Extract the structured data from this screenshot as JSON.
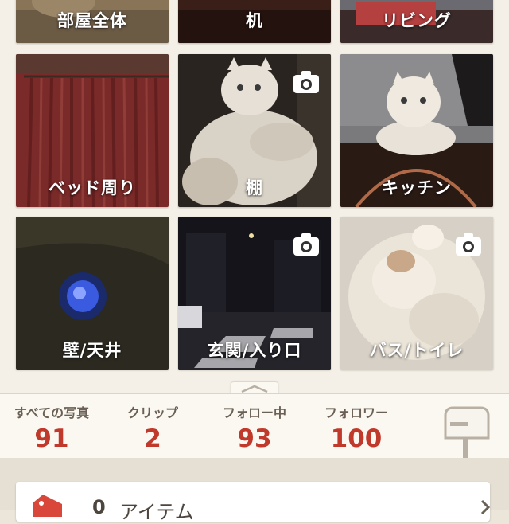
{
  "rooms": {
    "row0": [
      {
        "label": "部屋全体"
      },
      {
        "label": "机"
      },
      {
        "label": "リビング"
      }
    ],
    "row1": [
      {
        "label": "ベッド周り"
      },
      {
        "label": "棚"
      },
      {
        "label": "キッチン"
      }
    ],
    "row2": [
      {
        "label": "壁/天井"
      },
      {
        "label": "玄関/入り口"
      },
      {
        "label": "バス/トイレ"
      }
    ]
  },
  "stats": {
    "all_photos": {
      "label": "すべての写真",
      "value": "91"
    },
    "clips": {
      "label": "クリップ",
      "value": "2"
    },
    "following": {
      "label": "フォロー中",
      "value": "93"
    },
    "followers": {
      "label": "フォロワー",
      "value": "100"
    }
  },
  "items_row": {
    "count": "0",
    "label": "アイテム"
  },
  "colors": {
    "accent": "#c0392b",
    "background": "#f4f0e7"
  },
  "icons": [
    "camera-icon",
    "mailbox-icon",
    "tag-icon",
    "chevron-right-icon",
    "chevron-up-icon"
  ]
}
